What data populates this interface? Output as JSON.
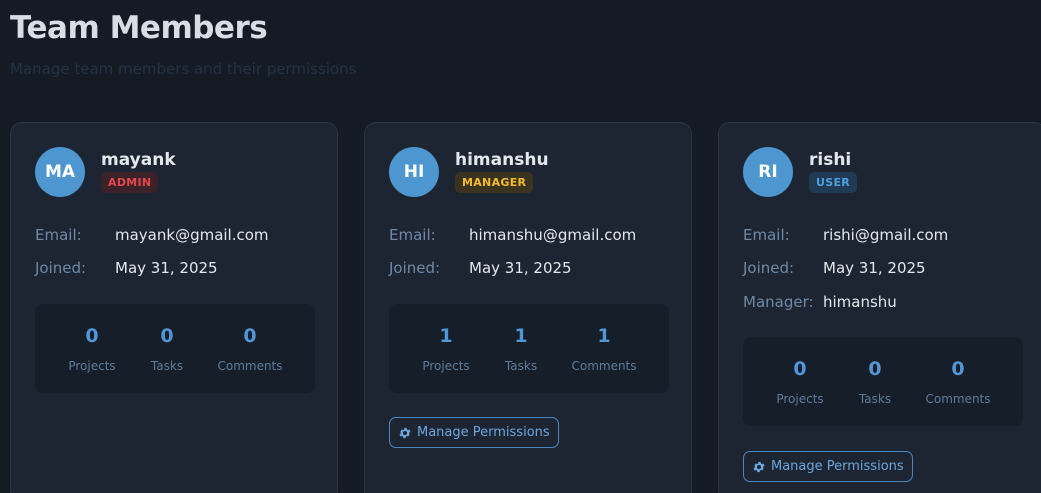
{
  "header": {
    "title": "Team Members",
    "subtitle": "Manage team members and their permissions"
  },
  "labels": {
    "email": "Email:",
    "joined": "Joined:",
    "manager": "Manager:",
    "projects": "Projects",
    "tasks": "Tasks",
    "comments": "Comments",
    "manage_permissions": "Manage Permissions"
  },
  "members": [
    {
      "initials": "MA",
      "name": "mayank",
      "role": "ADMIN",
      "email": "mayank@gmail.com",
      "joined": "May 31, 2025",
      "stats": {
        "projects": "0",
        "tasks": "0",
        "comments": "0"
      }
    },
    {
      "initials": "HI",
      "name": "himanshu",
      "role": "MANAGER",
      "email": "himanshu@gmail.com",
      "joined": "May 31, 2025",
      "stats": {
        "projects": "1",
        "tasks": "1",
        "comments": "1"
      }
    },
    {
      "initials": "RI",
      "name": "rishi",
      "role": "USER",
      "email": "rishi@gmail.com",
      "joined": "May 31, 2025",
      "manager": "himanshu",
      "stats": {
        "projects": "0",
        "tasks": "0",
        "comments": "0"
      }
    }
  ],
  "colors": {
    "background": "#141b25",
    "card": "#1d2532",
    "avatar": "#4e96cf",
    "accent": "#5196d6",
    "admin": "#e6474f",
    "manager": "#f4bb2e",
    "user": "#4ea0e0"
  },
  "icons": {
    "manage_permissions": "gear-icon"
  }
}
